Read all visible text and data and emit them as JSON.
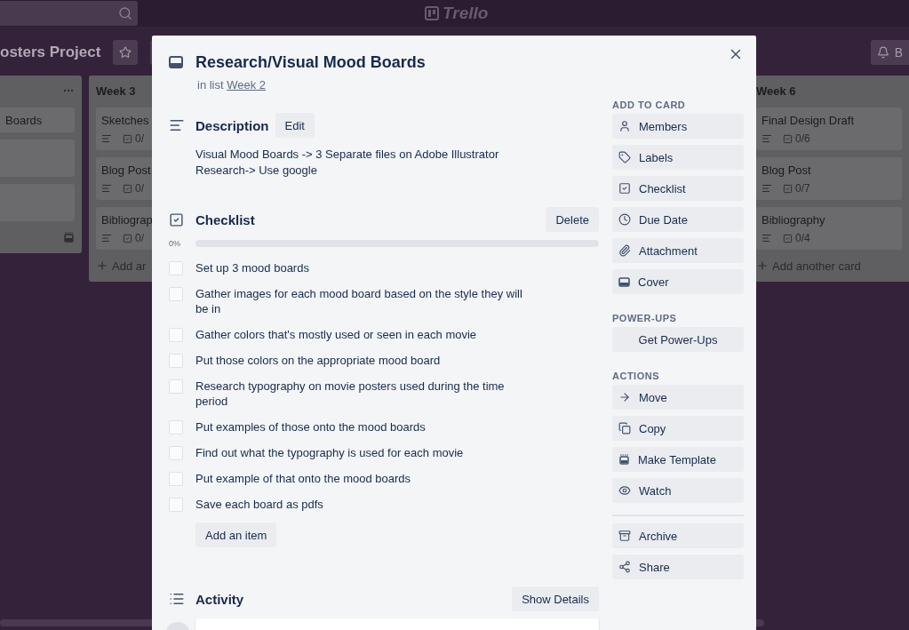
{
  "top_bar": {
    "logo": "Trello"
  },
  "board": {
    "title": "osters Project",
    "right_button": "B"
  },
  "lists": [
    {
      "kind": "cut",
      "cards": [
        {
          "kind": "text",
          "title": "Boards"
        },
        {
          "kind": "blank"
        },
        {
          "kind": "blank"
        }
      ]
    },
    {
      "kind": "covered",
      "title": "Week 3",
      "cards": [
        {
          "kind": "text",
          "title": "Sketches",
          "badge": "0/"
        },
        {
          "kind": "text",
          "title": "Blog Post",
          "badge": "0/"
        },
        {
          "kind": "text",
          "title": "Bibliograp",
          "badge": "0/"
        }
      ],
      "add": "Add ar"
    },
    {
      "kind": "full",
      "title": "Week 6",
      "cards": [
        {
          "kind": "text",
          "title": "Final Design Draft",
          "badge": "0/6"
        },
        {
          "kind": "text",
          "title": "Blog Post",
          "badge": "0/7"
        },
        {
          "kind": "text",
          "title": "Bibliography",
          "badge": "0/4"
        }
      ],
      "add": "Add another card"
    }
  ],
  "card": {
    "title": "Research/Visual Mood Boards",
    "list_prefix": "in list",
    "list_link": "Week 2"
  },
  "description": {
    "heading": "Description",
    "edit": "Edit",
    "lines": [
      "Visual Mood Boards -> 3 Separate files on Adobe Illustrator",
      "Research-> Use google"
    ]
  },
  "checklist": {
    "heading": "Checklist",
    "delete": "Delete",
    "percent": "0%",
    "level": 0,
    "add": "Add an item",
    "items": [
      {
        "text": "Set up 3 mood boards",
        "checked": false
      },
      {
        "text": "Gather images for each mood board based on the style they will be in",
        "checked": false
      },
      {
        "text": "Gather colors that's mostly used or seen in each movie",
        "checked": false
      },
      {
        "text": "Put those colors on the appropriate mood board",
        "checked": false
      },
      {
        "text": "Research typography on movie posters used during the time period",
        "checked": false
      },
      {
        "text": "Put examples of those onto the mood boards",
        "checked": false
      },
      {
        "text": "Find out what the typography is used for each movie",
        "checked": false
      },
      {
        "text": "Put example of that onto the mood boards",
        "checked": false
      },
      {
        "text": "Save each board as pdfs",
        "checked": false
      }
    ]
  },
  "activity": {
    "heading": "Activity",
    "button": "Show Details"
  },
  "sidebar": [
    {
      "heading": "ADD TO CARD",
      "buttons": [
        {
          "kind": "members",
          "label": "Members"
        },
        {
          "kind": "labels",
          "label": "Labels"
        },
        {
          "kind": "checklist",
          "label": "Checklist"
        },
        {
          "kind": "due",
          "label": "Due Date"
        },
        {
          "kind": "attachment",
          "label": "Attachment"
        },
        {
          "kind": "cover",
          "label": "Cover"
        }
      ]
    },
    {
      "heading": "POWER-UPS",
      "buttons": [
        {
          "kind": "plain",
          "label": "Get Power-Ups"
        }
      ]
    },
    {
      "heading": "ACTIONS",
      "buttons": [
        {
          "kind": "move",
          "label": "Move"
        },
        {
          "kind": "copy",
          "label": "Copy"
        },
        {
          "kind": "template",
          "label": "Make Template"
        },
        {
          "kind": "watch",
          "label": "Watch"
        }
      ]
    },
    {
      "buttons": [
        {
          "kind": "archive",
          "label": "Archive"
        },
        {
          "kind": "share",
          "label": "Share"
        }
      ]
    }
  ]
}
